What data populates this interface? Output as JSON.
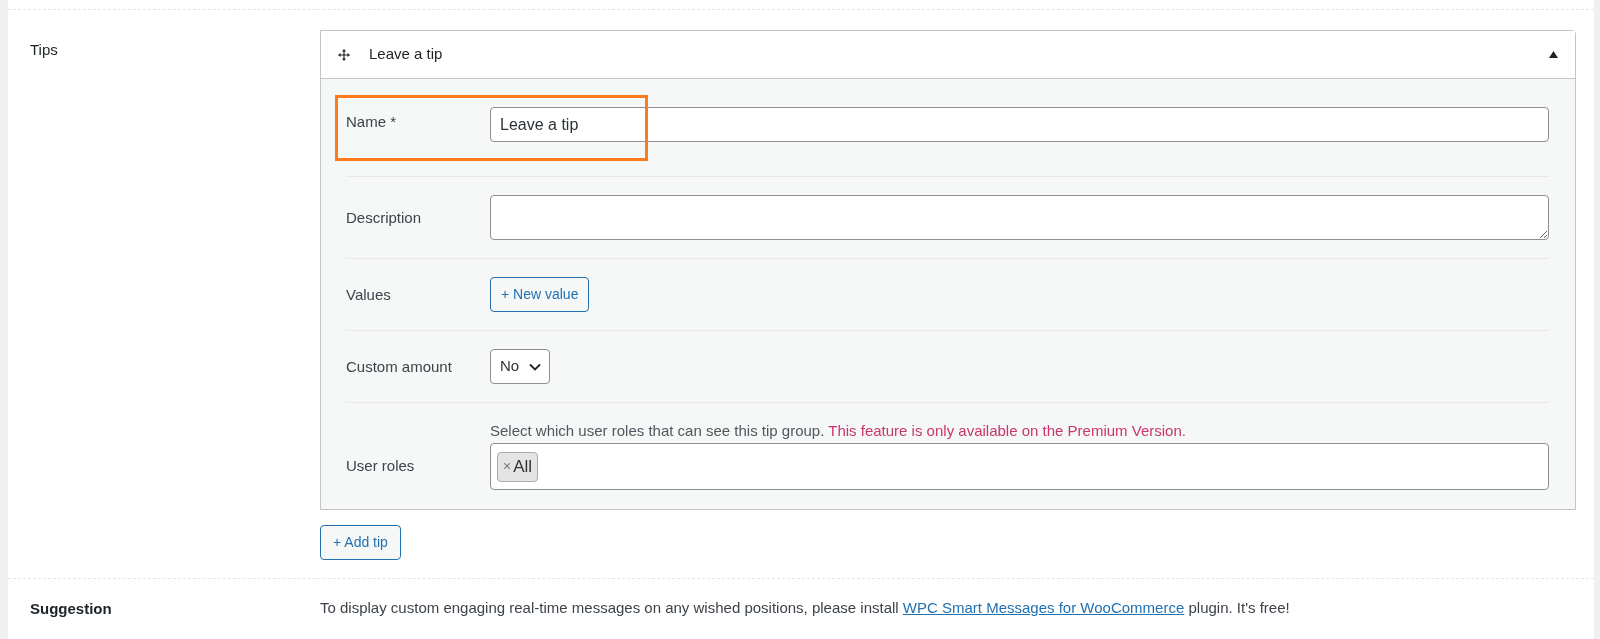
{
  "tips_section": {
    "label": "Tips",
    "panel": {
      "title": "Leave a tip",
      "expanded": true,
      "fields": [
        {
          "kind": "text",
          "label": "Name *",
          "value": "Leave a tip",
          "highlighted": true
        },
        {
          "kind": "textarea",
          "label": "Description"
        },
        {
          "kind": "button",
          "label": "Values",
          "button": "+ New value"
        },
        {
          "kind": "select",
          "label": "Custom amount",
          "value": "No"
        },
        {
          "kind": "tags",
          "label": "User roles",
          "hint": "Select which user roles that can see this tip group.",
          "notice": "This feature is only available on the Premium Version.",
          "tags": [
            {
              "remove": "×",
              "label": "All"
            }
          ]
        }
      ]
    },
    "add_button": "+ Add tip"
  },
  "suggestion_section": {
    "label": "Suggestion",
    "text_before": "To display custom engaging real-time messages on any wished positions, please install",
    "link": "WPC Smart Messages for WooCommerce",
    "text_after": "plugin. It's free!"
  }
}
